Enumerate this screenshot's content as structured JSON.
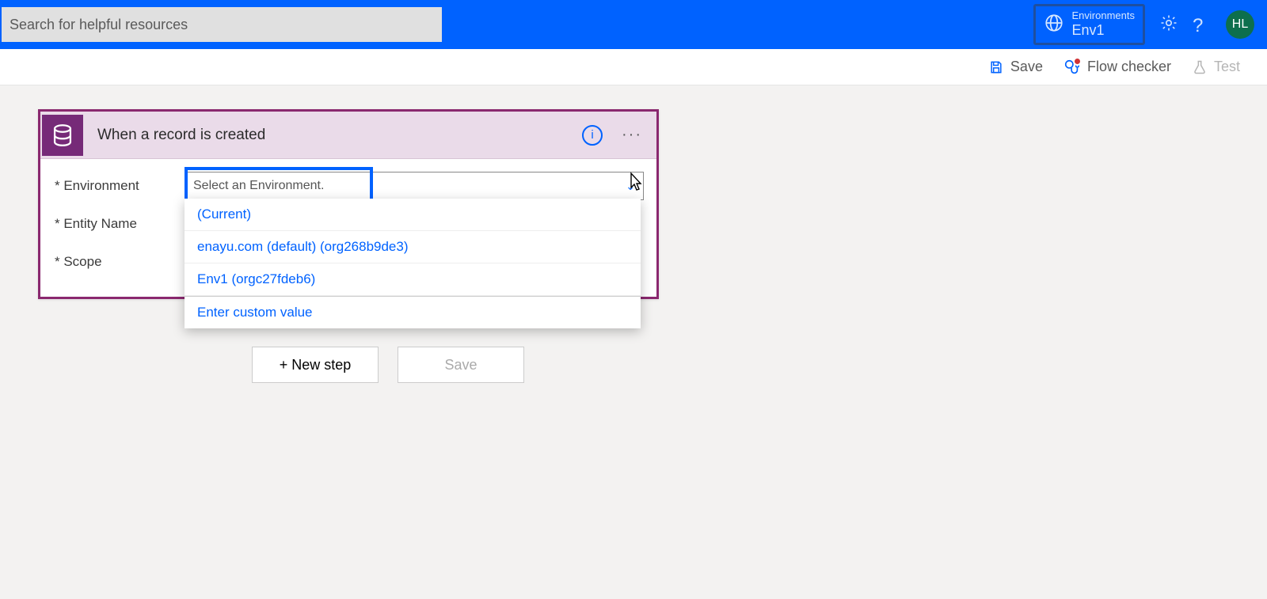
{
  "header": {
    "search_placeholder": "Search for helpful resources",
    "env_label": "Environments",
    "env_value": "Env1",
    "avatar_initials": "HL"
  },
  "toolbar": {
    "save": "Save",
    "flow_checker": "Flow checker",
    "test": "Test"
  },
  "trigger": {
    "title": "When a record is created",
    "fields": {
      "environment_label": "* Environment",
      "entity_label": "* Entity Name",
      "scope_label": "* Scope",
      "environment_placeholder": "Select an Environment."
    }
  },
  "dropdown": {
    "items": [
      "(Current)",
      "enayu.com (default) (org268b9de3)",
      "Env1 (orgc27fdeb6)"
    ],
    "custom": "Enter custom value"
  },
  "buttons": {
    "new_step": "+ New step",
    "save": "Save"
  }
}
